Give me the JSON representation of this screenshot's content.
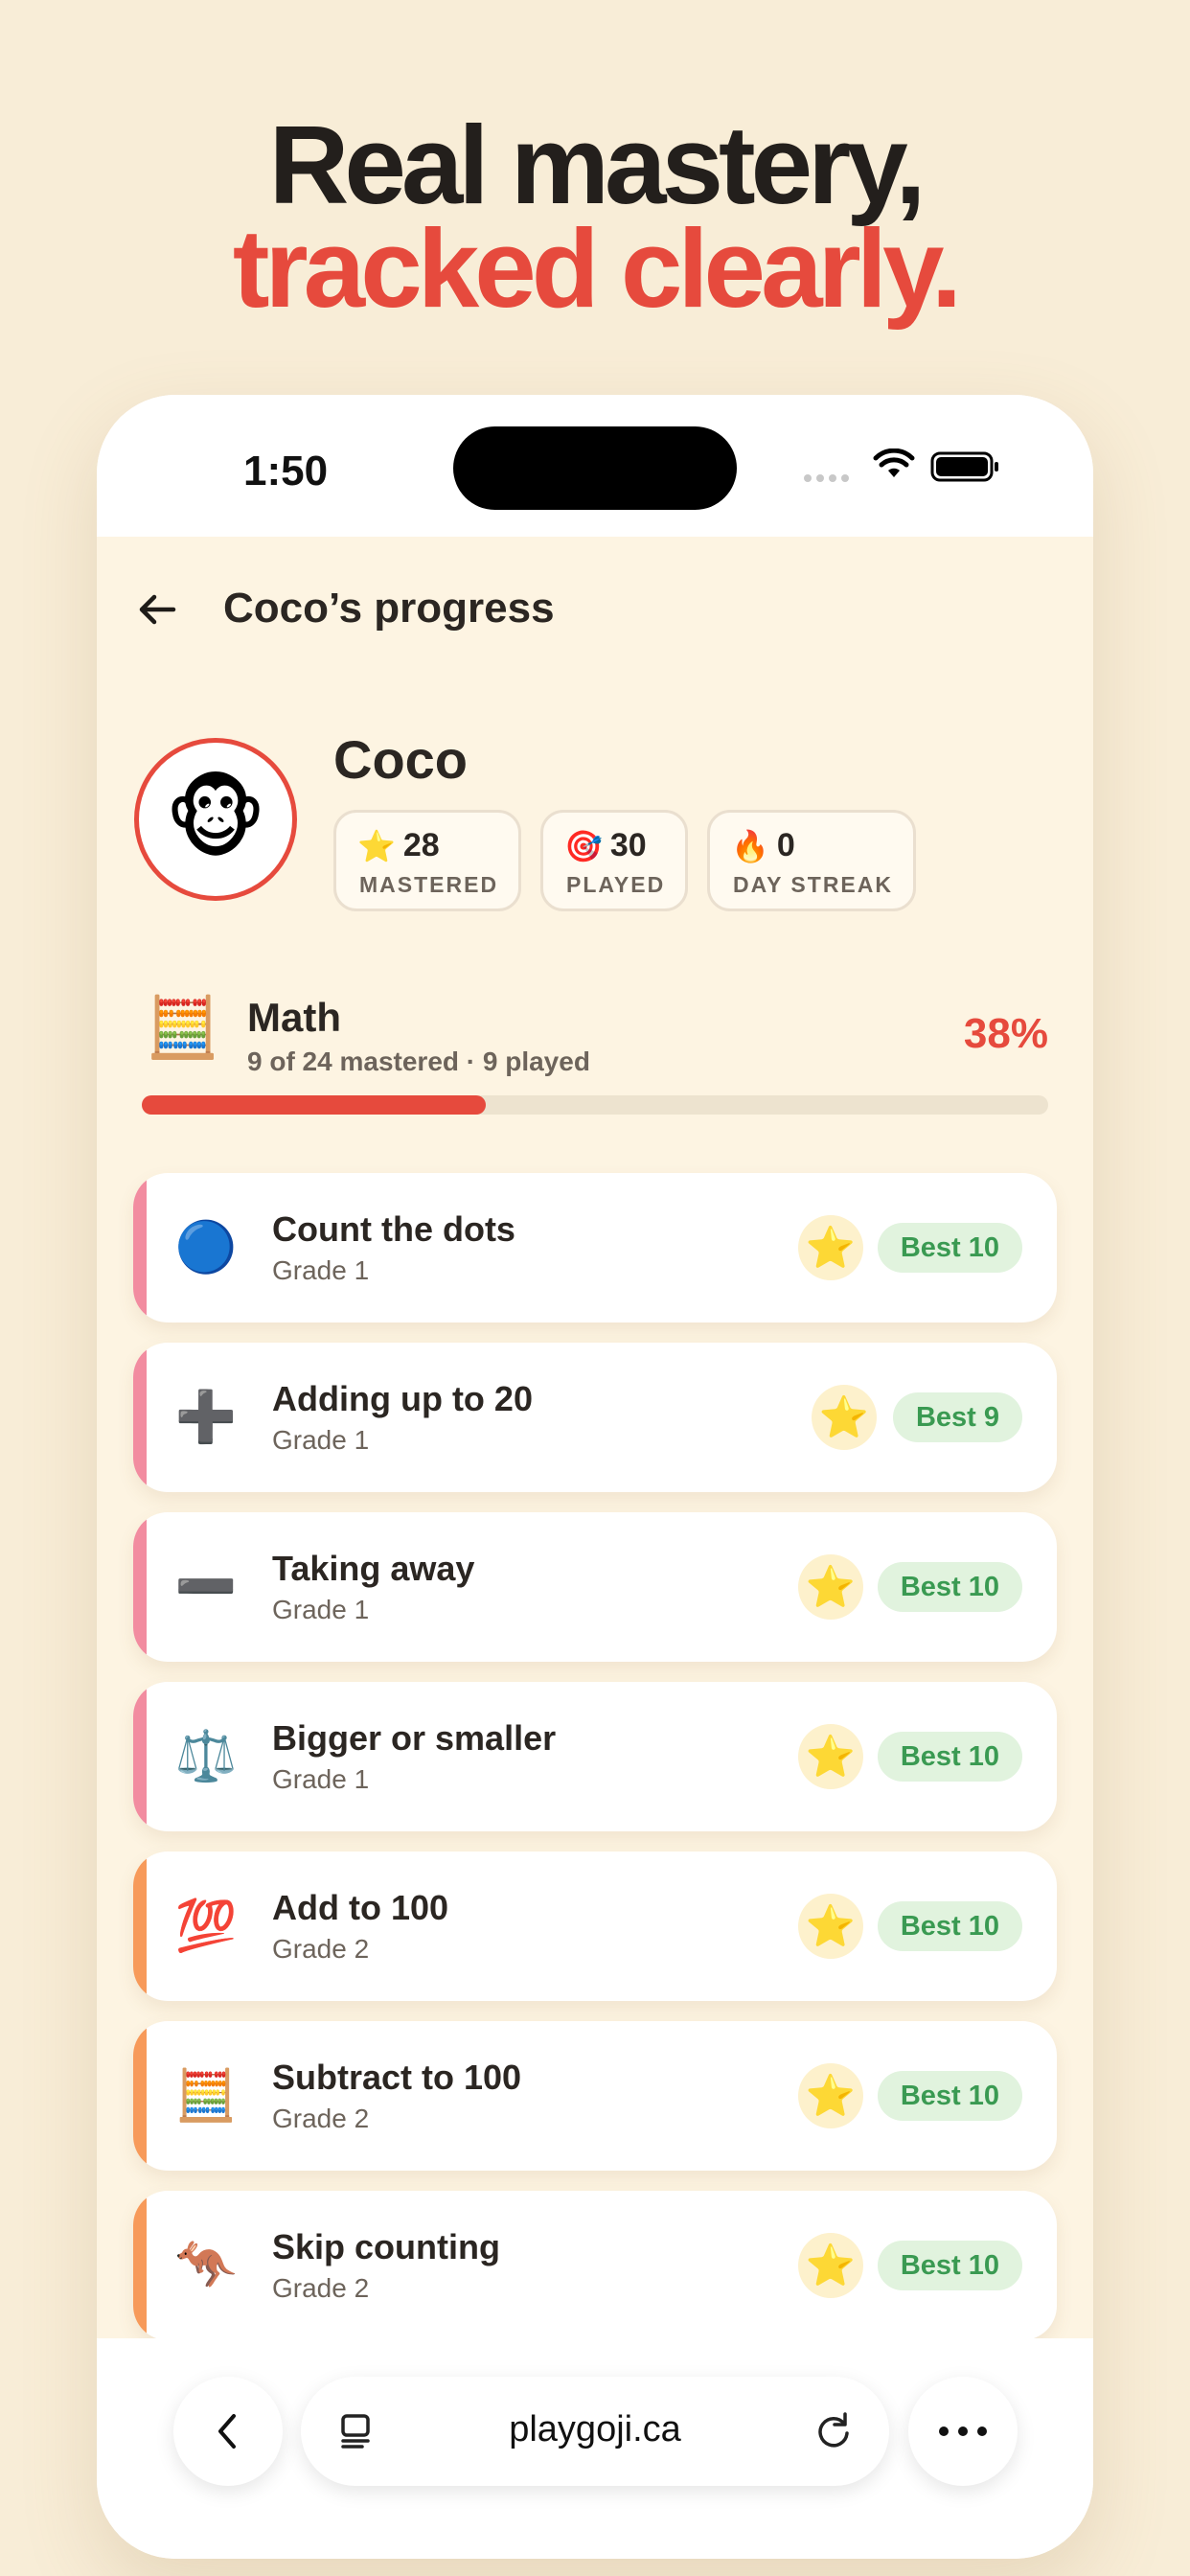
{
  "headline": {
    "line1": "Real mastery,",
    "line2": "tracked clearly."
  },
  "status_bar": {
    "time": "1:50"
  },
  "nav": {
    "title": "Coco’s progress"
  },
  "profile": {
    "name": "Coco",
    "avatar_emoji": "🐵",
    "stats": [
      {
        "icon": "⭐",
        "value": "28",
        "label": "MASTERED"
      },
      {
        "icon": "🎯",
        "value": "30",
        "label": "PLAYED"
      },
      {
        "icon": "🔥",
        "value": "0",
        "label": "DAY STREAK"
      }
    ]
  },
  "subject": {
    "icon": "🧮",
    "name": "Math",
    "summary": "9 of 24 mastered · 9 played",
    "percent_label": "38%",
    "progress_fraction": 0.38
  },
  "skills": [
    {
      "icon": "🔵",
      "title": "Count the dots",
      "grade": "Grade 1",
      "best": "Best 10",
      "accent": "#f28ca0"
    },
    {
      "icon": "➕",
      "title": "Adding up to 20",
      "grade": "Grade 1",
      "best": "Best 9",
      "accent": "#f28ca0"
    },
    {
      "icon": "➖",
      "title": "Taking away",
      "grade": "Grade 1",
      "best": "Best 10",
      "accent": "#f28ca0"
    },
    {
      "icon": "⚖️",
      "title": "Bigger or smaller",
      "grade": "Grade 1",
      "best": "Best 10",
      "accent": "#f28ca0"
    },
    {
      "icon": "💯",
      "title": "Add to 100",
      "grade": "Grade 2",
      "best": "Best 10",
      "accent": "#f79a5a"
    },
    {
      "icon": "🧮",
      "title": "Subtract to 100",
      "grade": "Grade 2",
      "best": "Best 10",
      "accent": "#f79a5a"
    },
    {
      "icon": "🦘",
      "title": "Skip counting",
      "grade": "Grade 2",
      "best": "Best 10",
      "accent": "#f79a5a"
    }
  ],
  "browser": {
    "url": "playgoji.ca"
  },
  "colors": {
    "brand_red": "#e64a3d",
    "background": "#f8edd7",
    "app_background": "#fdf4e2",
    "grade1_accent": "#f28ca0",
    "grade2_accent": "#f79a5a",
    "best_badge_bg": "#e1f3de",
    "best_badge_text": "#3a9a52"
  }
}
